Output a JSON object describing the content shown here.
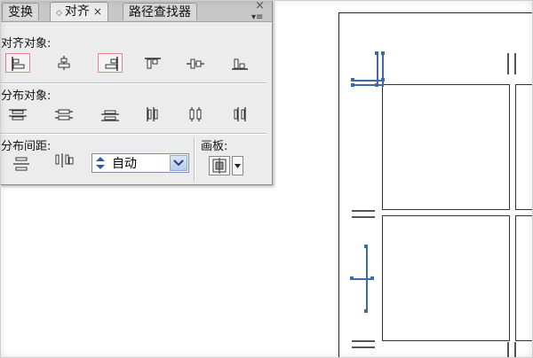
{
  "panel": {
    "tabs": [
      {
        "label": "变换",
        "active": false
      },
      {
        "label": "对齐",
        "active": true
      },
      {
        "label": "路径查找器",
        "active": false
      }
    ],
    "active_tab_close": "×",
    "close_glyph": "×",
    "menu_glyph": "▾≡",
    "sections": {
      "align_objects": "对齐对象:",
      "distribute_objects": "分布对象:",
      "distribute_spacing": "分布间距:",
      "align_to": "画板:"
    },
    "spacing_value": "自动"
  },
  "colors": {
    "selected_border": "#e5828c",
    "guide_blue": "#3e6aa8",
    "panel_bg": "#ececec"
  },
  "icons": {
    "align_objects": [
      "horizontal-align-left-icon",
      "horizontal-align-center-icon",
      "horizontal-align-right-icon",
      "vertical-align-top-icon",
      "vertical-align-center-icon",
      "vertical-align-bottom-icon"
    ],
    "distribute_objects": [
      "vertical-distribute-top-icon",
      "vertical-distribute-center-icon",
      "vertical-distribute-bottom-icon",
      "horizontal-distribute-left-icon",
      "horizontal-distribute-center-icon",
      "horizontal-distribute-right-icon"
    ],
    "distribute_spacing": [
      "vertical-distribute-space-icon",
      "horizontal-distribute-space-icon"
    ],
    "align_to": [
      "align-to-artboard-icon"
    ]
  }
}
